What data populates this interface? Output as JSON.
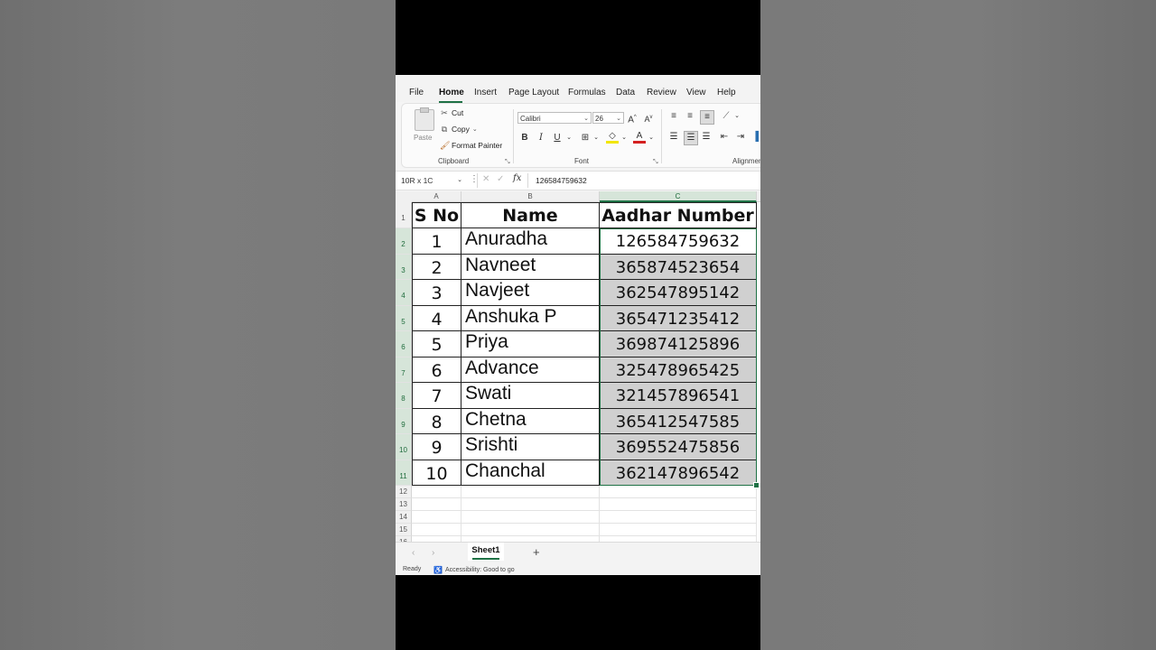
{
  "menu": {
    "tabs": [
      "File",
      "Home",
      "Insert",
      "Page Layout",
      "Formulas",
      "Data",
      "Review",
      "View",
      "Help"
    ],
    "active": "Home"
  },
  "ribbon": {
    "paste_label": "Paste",
    "cut_label": "Cut",
    "copy_label": "Copy",
    "format_painter_label": "Format Painter",
    "clipboard_group": "Clipboard",
    "font_name": "Calibri",
    "font_size": "26",
    "font_group": "Font",
    "alignment_group": "Alignmen",
    "bold": "B",
    "italic": "I",
    "underline": "U"
  },
  "formula_bar": {
    "name_box": "10R x 1C",
    "fx": "fx",
    "value": "126584759632"
  },
  "grid": {
    "columns": [
      "A",
      "B",
      "C"
    ],
    "selected_column": "C",
    "header_row": [
      "S No",
      "Name",
      "Aadhar Number"
    ],
    "rows": [
      {
        "sno": "1",
        "name": "Anuradha",
        "aadhar": "126584759632"
      },
      {
        "sno": "2",
        "name": "Navneet",
        "aadhar": "365874523654"
      },
      {
        "sno": "3",
        "name": "Navjeet",
        "aadhar": "362547895142"
      },
      {
        "sno": "4",
        "name": "Anshuka P",
        "aadhar": "365471235412"
      },
      {
        "sno": "5",
        "name": "Priya",
        "aadhar": "369874125896"
      },
      {
        "sno": "6",
        "name": "Advance",
        "aadhar": "325478965425"
      },
      {
        "sno": "7",
        "name": "Swati",
        "aadhar": "321457896541"
      },
      {
        "sno": "8",
        "name": "Chetna",
        "aadhar": "365412547585"
      },
      {
        "sno": "9",
        "name": "Srishti",
        "aadhar": "369552475856"
      },
      {
        "sno": "10",
        "name": "Chanchal",
        "aadhar": "362147896542"
      }
    ],
    "row_numbers": [
      "1",
      "2",
      "3",
      "4",
      "5",
      "6",
      "7",
      "8",
      "9",
      "10",
      "11",
      "12",
      "13",
      "14",
      "15",
      "16"
    ]
  },
  "sheets": {
    "tabs": [
      "Sheet1"
    ],
    "active": "Sheet1",
    "add": "+"
  },
  "status": {
    "ready": "Ready",
    "accessibility": "Accessibility: Good to go"
  },
  "colors": {
    "accent": "#1e7145",
    "selection_fill": "#d0d0d0"
  }
}
